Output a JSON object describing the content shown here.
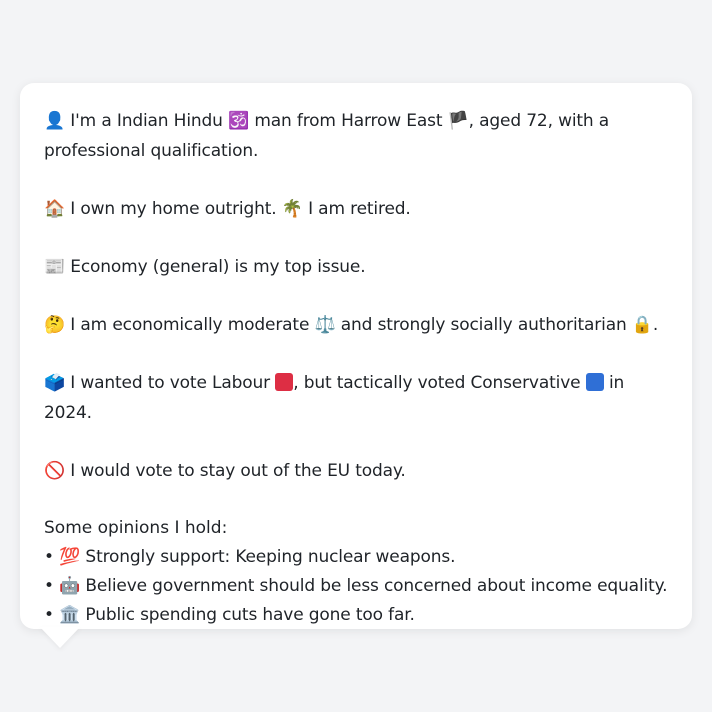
{
  "profile": {
    "intro": {
      "icon": "👤",
      "part1": "I'm a Indian Hindu",
      "religion_icon": "🕉️",
      "part2": "man from Harrow East",
      "flag_icon": "🏴",
      "part3": ", aged 72, with a professional qualification."
    },
    "housing": {
      "icon": "🏠",
      "text1": "I own my home outright.",
      "retired_icon": "🌴",
      "text2": "I am retired."
    },
    "issue": {
      "icon": "📰",
      "text": "Economy (general) is my top issue."
    },
    "ideology": {
      "icon": "🤔",
      "text1": "I am economically moderate",
      "scale_icon": "⚖️",
      "text2": "and strongly socially authoritarian",
      "lock_icon": "🔒",
      "text3": "."
    },
    "vote": {
      "icon": "🗳️",
      "text1": "I wanted to vote Labour",
      "text2": ", but tactically voted Conservative",
      "text3": "in 2024.",
      "labour_color": "#dd2e44",
      "conservative_color": "#2f6fd6"
    },
    "eu": {
      "icon": "🚫",
      "text": "I would vote to stay out of the EU today."
    },
    "opinions": {
      "heading": "Some opinions I hold:",
      "items": [
        {
          "bullet": "•",
          "icon": "💯",
          "text": "Strongly support: Keeping nuclear weapons."
        },
        {
          "bullet": "•",
          "icon": "🤖",
          "text": "Believe government should be less concerned about income equality."
        },
        {
          "bullet": "•",
          "icon": "🏛️",
          "text": "Public spending cuts have gone too far."
        }
      ]
    }
  }
}
